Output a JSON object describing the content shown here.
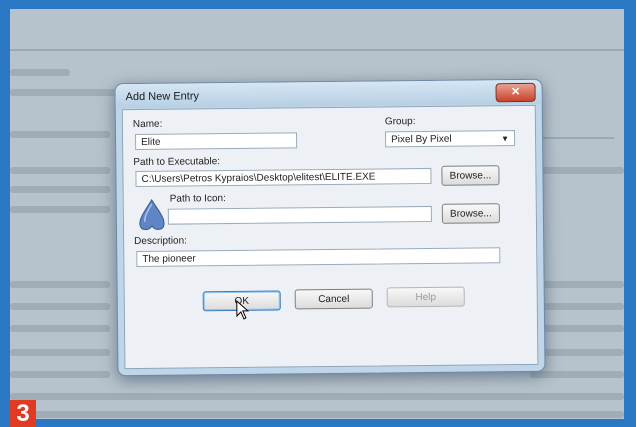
{
  "step_number": "3",
  "dialog": {
    "title": "Add New Entry",
    "close_symbol": "✕",
    "name_label": "Name:",
    "name_value": "Elite",
    "group_label": "Group:",
    "group_value": "Pixel By Pixel",
    "executable_label": "Path to Executable:",
    "executable_value": "C:\\Users\\Petros Kypraios\\Desktop\\elitest\\ELITE.EXE",
    "browse_label_1": "Browse...",
    "icon_label": "Path to Icon:",
    "icon_value": "",
    "browse_label_2": "Browse...",
    "description_label": "Description:",
    "description_value": "The pioneer",
    "ok_label": "OK",
    "cancel_label": "Cancel",
    "help_label": "Help"
  },
  "colors": {
    "frame": "#2a78c4",
    "badge": "#e03a22",
    "icon_fill": "#5f85c5"
  }
}
